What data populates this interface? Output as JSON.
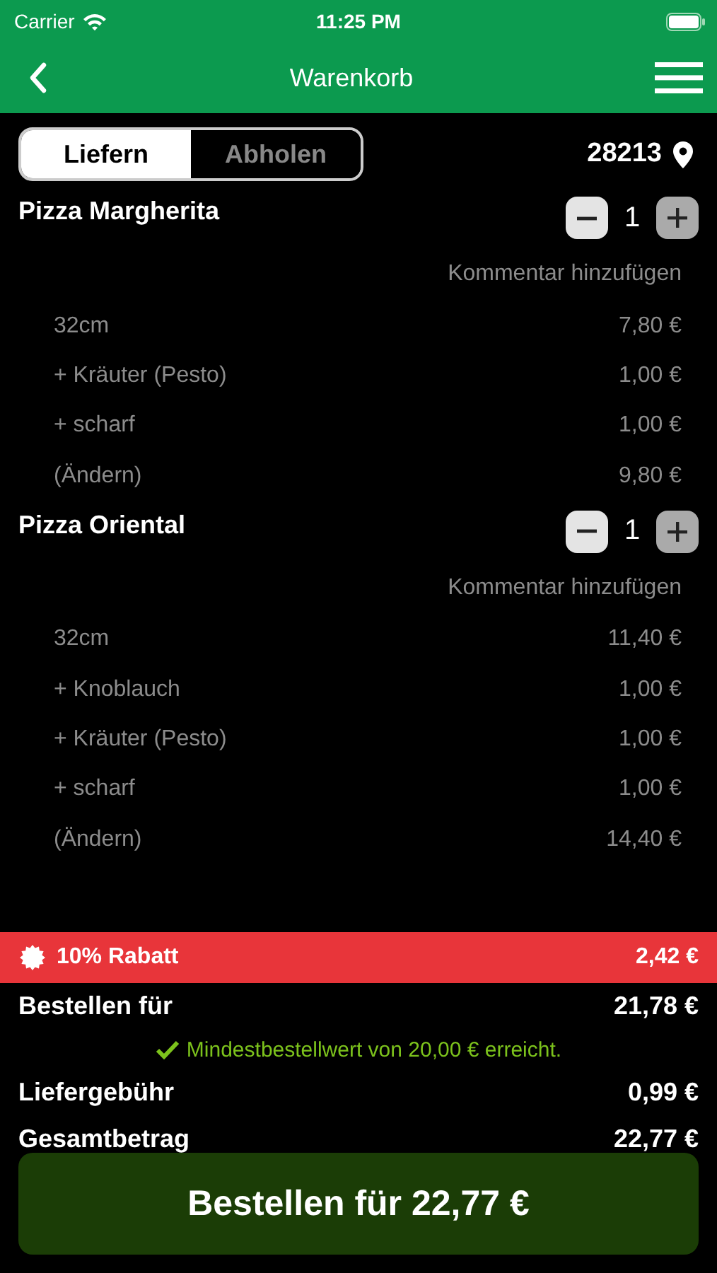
{
  "status_bar": {
    "carrier": "Carrier",
    "time": "11:25 PM"
  },
  "nav": {
    "title": "Warenkorb"
  },
  "mode_tabs": [
    {
      "label": "Liefern",
      "selected": true
    },
    {
      "label": "Abholen",
      "selected": false
    }
  ],
  "postcode": "28213",
  "items": [
    {
      "name": "Pizza Margherita",
      "quantity": "1",
      "comment": "Kommentar hinzufügen",
      "options": [
        {
          "label": "32cm",
          "price": "7,80 €"
        },
        {
          "label": "+ Kräuter (Pesto)",
          "price": "1,00 €"
        },
        {
          "label": "+ scharf",
          "price": "1,00 €"
        },
        {
          "label": "(Ändern)",
          "price": "9,80 €"
        }
      ]
    },
    {
      "name": "Pizza Oriental",
      "quantity": "1",
      "comment": "Kommentar hinzufügen",
      "options": [
        {
          "label": "32cm",
          "price": "11,40 €"
        },
        {
          "label": "+ Knoblauch",
          "price": "1,00 €"
        },
        {
          "label": "+ Kräuter (Pesto)",
          "price": "1,00 €"
        },
        {
          "label": "+ scharf",
          "price": "1,00 €"
        },
        {
          "label": "(Ändern)",
          "price": "14,40 €"
        }
      ]
    }
  ],
  "discount": {
    "label": "10% Rabatt",
    "amount": "2,42 €"
  },
  "subtotal": {
    "label": "Bestellen für",
    "amount": "21,78 €"
  },
  "minimum_notice": "Mindestbestellwert von 20,00 € erreicht.",
  "delivery_fee": {
    "label": "Liefergebühr",
    "amount": "0,99 €"
  },
  "total": {
    "label": "Gesamtbetrag",
    "amount": "22,77 €"
  },
  "order_button": "Bestellen für 22,77 €"
}
